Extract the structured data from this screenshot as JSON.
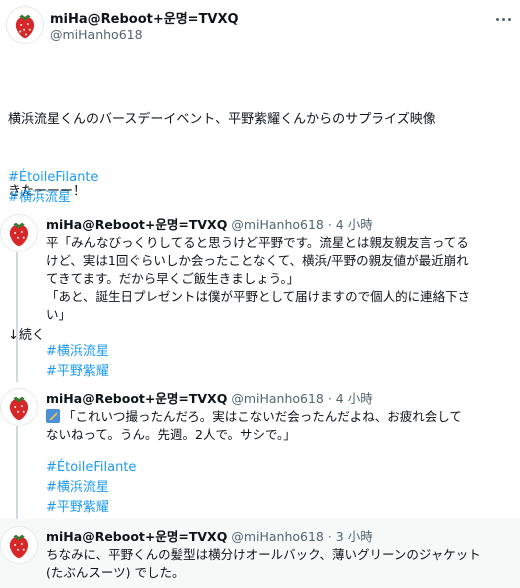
{
  "main_tweet": {
    "author_name": "miHa@Reboot+운명=TVXQ",
    "author_handle": "@miHanho618",
    "text_line1": "横浜流星くんのバースデーイベント、平野紫耀くんからのサプライズ映像",
    "text_line2": "きたーーー！",
    "text_line3": "↓続く",
    "hashtags": [
      "#ÉtoileFilante",
      "#横浜流星"
    ]
  },
  "replies": [
    {
      "author_name": "miHa@Reboot+운명=TVXQ",
      "author_handle": "@miHanho618",
      "meta": "· 4 小時",
      "lines": [
        "平「みんなびっくりしてると思うけど平野です。流星とは親友親友言ってる",
        "けど、実は1回ぐらいしか会ったことなくて、横浜/平野の親友値が最近崩れ",
        "てきてます。だから早くご飯生きましょう。」",
        "「あと、誕生日プレゼントは僕が平野として届けますので個人的に連絡下さ",
        "い」"
      ],
      "hashtags": [
        "#横浜流星",
        "#平野紫耀"
      ]
    },
    {
      "author_name": "miHa@Reboot+운명=TVXQ",
      "author_handle": "@miHanho618",
      "meta": "· 4 小時",
      "emoji": "film-frames-emoji",
      "lines": [
        "「これいつ撮ったんだろ。実はこないだ会ったんだよね、お疲れ会して",
        "ないねって。うん。先週。2人で。サシで。」"
      ],
      "hashtags": [
        "#ÉtoileFilante",
        "#横浜流星",
        "#平野紫耀"
      ]
    },
    {
      "author_name": "miHa@Reboot+운명=TVXQ",
      "author_handle": "@miHanho618",
      "meta": "· 3 小時",
      "lines": [
        "ちなみに、平野くんの髪型は横分けオールバック、薄いグリーンのジャケット",
        "(たぶんスーツ) でした。"
      ]
    }
  ],
  "colors": {
    "text": "#0f1419",
    "muted": "#536471",
    "link": "#1d9bf0",
    "thread_line": "#cfd9de"
  }
}
